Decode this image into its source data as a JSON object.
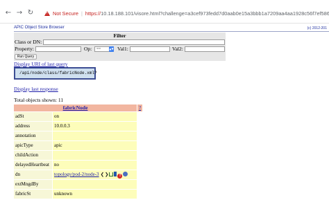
{
  "browser": {
    "security_label": "Not Secure",
    "url_scheme": "https://",
    "url_rest": "10.18.188.101/visore.html?challenge=a3cef973fedd7d0aab0e15a3bbb1a7209aa4aa1928c56f7ef58673866cc",
    "back_icon": "back-arrow-icon",
    "forward_icon": "forward-arrow-icon",
    "reload_icon": "reload-icon",
    "warning_icon": "warning-triangle-icon"
  },
  "app": {
    "title": "APIC Object Store Browser",
    "copyright": "(c) 2012-201"
  },
  "filter": {
    "title": "Filter",
    "class_dn_label": "Class or DN:",
    "class_dn_value": "",
    "property_label": "Property:",
    "property_value": "",
    "op_label": "Op:",
    "op_value": "==",
    "val1_label": "Val1:",
    "val1_value": "",
    "val2_label": "Val2:",
    "val2_value": "",
    "run_button": "Run Query"
  },
  "links": {
    "display_uri": "Display URI of last query",
    "uri_text": "/api/node/class/fabricNode.xml?",
    "display_response": "Display last response"
  },
  "results": {
    "total_label": "Total objects shown: 11",
    "class_header": "fabricNode",
    "help_label": "?",
    "rows": [
      {
        "key": "adSt",
        "value": "on"
      },
      {
        "key": "address",
        "value": "10.0.0.3"
      },
      {
        "key": "annotation",
        "value": ""
      },
      {
        "key": "apicType",
        "value": "apic"
      },
      {
        "key": "childAction",
        "value": ""
      },
      {
        "key": "delayedHeartbeat",
        "value": "no"
      },
      {
        "key": "dn",
        "value": "topology/pod-2/node-3"
      },
      {
        "key": "extMngdBy",
        "value": ""
      },
      {
        "key": "fabricSt",
        "value": "unknown"
      }
    ],
    "dn_icons": [
      "left-arrow-icon",
      "right-arrow-icon",
      "tree-icon",
      "stats-icon",
      "fault-icon",
      "health-icon"
    ]
  },
  "colors": {
    "link": "#1b1ba8",
    "header_bg": "#f2b6a0",
    "key_bg": "#f7f7d7",
    "value_bg": "#fdfdba",
    "filter_bg": "#e6e6e6",
    "uri_box_bg": "#cfe0ef",
    "not_secure": "#c5221f"
  }
}
